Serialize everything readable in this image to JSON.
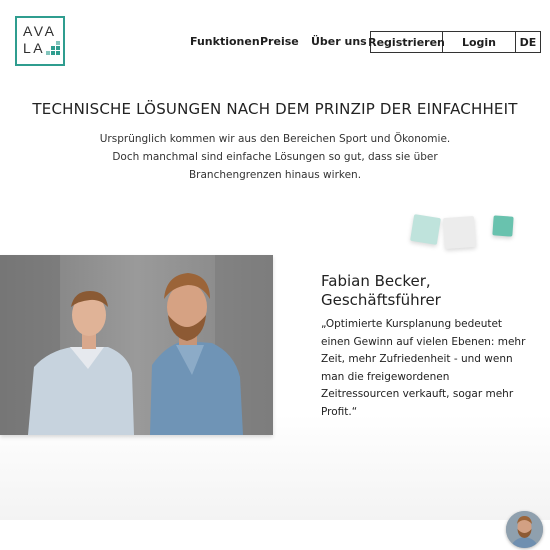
{
  "header": {
    "logo": {
      "line1": "AVA",
      "line2": "LA",
      "color": "#2f9d8f"
    },
    "nav": {
      "funktionen": "Funktionen",
      "preise": "Preise",
      "ueber_uns": "Über uns"
    },
    "buttons": {
      "register": "Registrieren",
      "login": "Login",
      "language": "DE"
    }
  },
  "hero": {
    "headline": "TECHNISCHE LÖSUNGEN NACH DEM PRINZIP DER EINFACHHEIT",
    "lines": [
      "Ursprünglich kommen wir aus den Bereichen Sport und Ökonomie.",
      "Doch manchmal sind einfache Lösungen so gut, dass sie über",
      "Branchengrenzen hinaus wirken."
    ]
  },
  "decor": {
    "square_colors": [
      "#bfe3dc",
      "#ececec",
      "#69c2ae"
    ]
  },
  "testimonial": {
    "name_line1": "Fabian Becker,",
    "name_line2": "Geschäftsführer",
    "quote_lines": [
      "„Optimierte Kursplanung bedeutet",
      "einen Gewinn auf vielen Ebenen: mehr",
      "Zeit, mehr Zufriedenheit - und wenn",
      "man die freigewordenen",
      "Zeitressourcen verkauft, sogar mehr",
      "Profit.“"
    ],
    "photo_icon": "team-photo"
  },
  "chat": {
    "avatar_icon": "chat-avatar-icon"
  }
}
